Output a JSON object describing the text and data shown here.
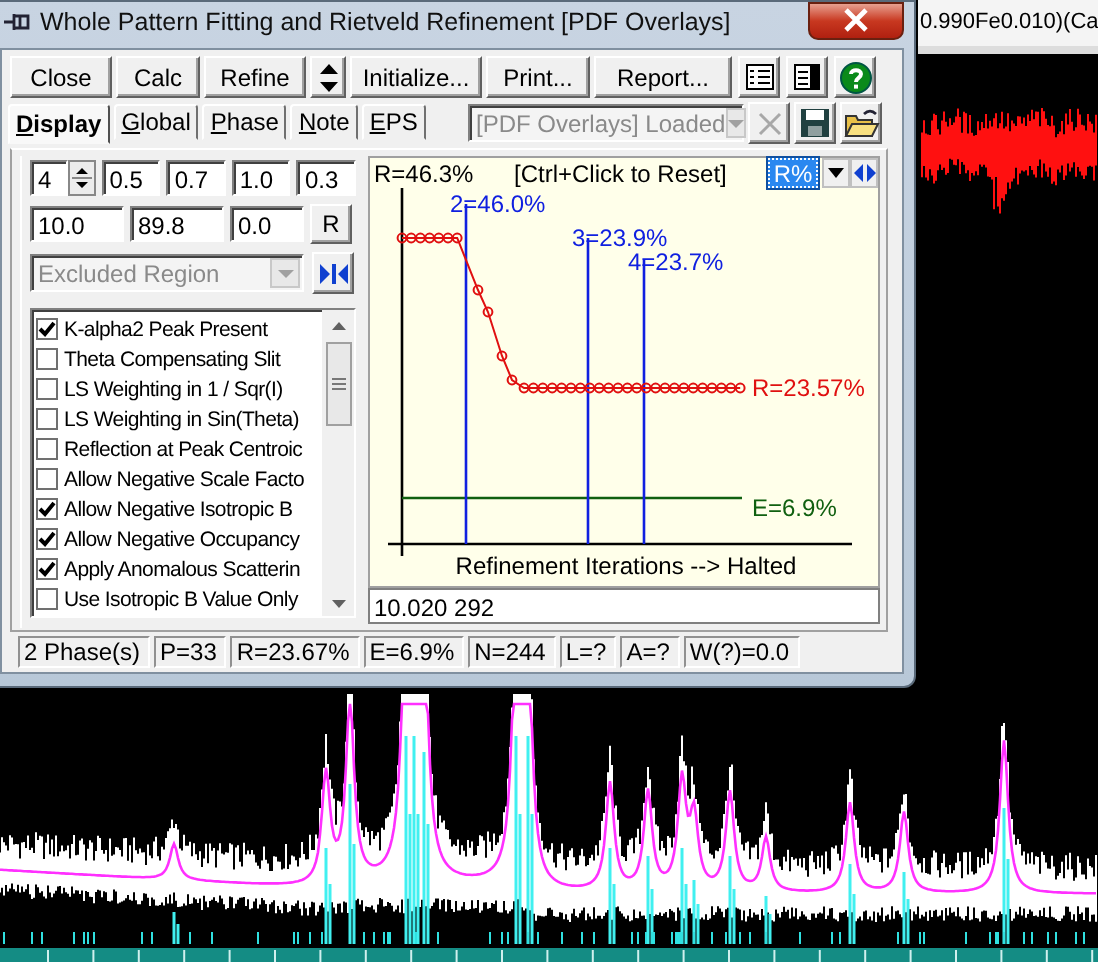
{
  "window": {
    "title": "Whole Pattern Fitting and Rietveld Refinement [PDF Overlays]"
  },
  "toolbar": [
    {
      "kind": "text",
      "label": "Close"
    },
    {
      "kind": "text",
      "label": "Calc"
    },
    {
      "kind": "text",
      "label": "Refine"
    },
    {
      "kind": "updown"
    },
    {
      "kind": "text",
      "label": "Initialize..."
    },
    {
      "kind": "text",
      "label": "Print..."
    },
    {
      "kind": "text",
      "label": "Report..."
    },
    {
      "kind": "list"
    },
    {
      "kind": "panel"
    },
    {
      "kind": "help"
    }
  ],
  "tabs": [
    {
      "label": "Display",
      "selected": true
    },
    {
      "label": "Global",
      "selected": false
    },
    {
      "label": "Phase",
      "selected": false
    },
    {
      "label": "Note",
      "selected": false
    },
    {
      "label": "EPS",
      "selected": false
    }
  ],
  "file_combo": {
    "value": "[PDF Overlays] Loaded",
    "disabled": true
  },
  "file_buttons": [
    {
      "kind": "clear",
      "disabled": true
    },
    {
      "kind": "save",
      "disabled": false
    },
    {
      "kind": "open",
      "disabled": false
    }
  ],
  "spin": {
    "value": "4"
  },
  "fields_row_1": [
    "0.5",
    "0.7",
    "1.0",
    "0.3"
  ],
  "fields_row_2": [
    "10.0",
    "89.8",
    "0.0"
  ],
  "r_button": "R",
  "region_combo": {
    "value": "Excluded Region",
    "disabled": true
  },
  "options": [
    {
      "label": "K-alpha2 Peak Present",
      "checked": true
    },
    {
      "label": "Theta Compensating Slit",
      "checked": false
    },
    {
      "label": "LS Weighting in 1 / Sqr(I)",
      "checked": false
    },
    {
      "label": "LS Weighting in Sin(Theta)",
      "checked": false
    },
    {
      "label": "Reflection at Peak Centroic",
      "checked": false
    },
    {
      "label": "Allow Negative Scale Facto",
      "checked": false
    },
    {
      "label": "Allow Negative Isotropic B",
      "checked": true
    },
    {
      "label": "Allow Negative Occupancy",
      "checked": true
    },
    {
      "label": "Apply Anomalous Scatterin",
      "checked": true
    },
    {
      "label": "Use Isotropic B Value Only",
      "checked": false
    }
  ],
  "chart": {
    "start_label": "R=46.3%",
    "hint": "[Ctrl+Click to Reset]",
    "selector": "R%",
    "markers": [
      "2=46.0%",
      "3=23.9%",
      "4=23.7%"
    ],
    "r_label": "R=23.57%",
    "e_label": "E=6.9%",
    "xlabel": "Refinement Iterations  -->  Halted"
  },
  "command_input": "10.020 292",
  "status_bar": [
    "2 Phase(s)",
    "P=33",
    "R=23.67%",
    "E=6.9%",
    "N=244",
    "L=?",
    "A=?",
    "W(?)=0.0"
  ],
  "background": {
    "title_fragment": "0.990Fe0.010)(Ca"
  }
}
